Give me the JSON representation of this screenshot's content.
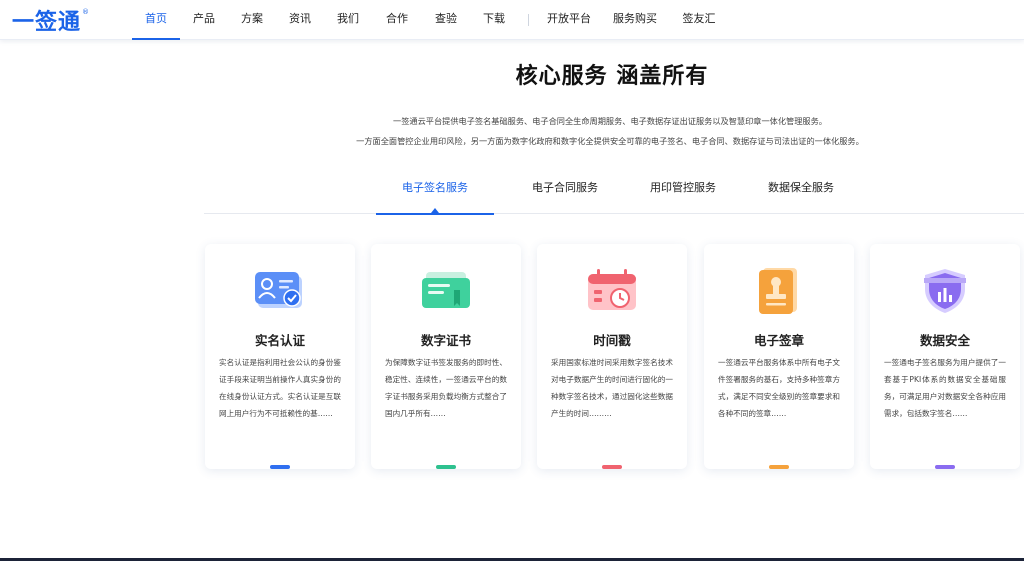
{
  "logo": {
    "text": "一签通",
    "mark": "®"
  },
  "nav": [
    {
      "label": "首页",
      "active": true
    },
    {
      "label": "产品"
    },
    {
      "label": "方案"
    },
    {
      "label": "资讯"
    },
    {
      "label": "我们"
    },
    {
      "label": "合作"
    },
    {
      "label": "查验"
    },
    {
      "label": "下载"
    },
    {
      "label": "开放平台"
    },
    {
      "label": "服务购买"
    },
    {
      "label": "签友汇"
    }
  ],
  "hero": {
    "headline": "核心服务 涵盖所有",
    "desc1": "一签通云平台提供电子签名基础服务、电子合同全生命周期服务、电子数据存证出证服务以及智慧印章一体化管理服务。",
    "desc2": "一方面全面管控企业用印风险，另一方面为数字化政府和数字化全提供安全可靠的电子签名、电子合同、数据存证与司法出证的一体化服务。"
  },
  "tabs": [
    {
      "label": "电子签名服务",
      "active": true
    },
    {
      "label": "电子合同服务"
    },
    {
      "label": "用印管控服务"
    },
    {
      "label": "数据保全服务"
    }
  ],
  "cards": [
    {
      "title": "实名认证",
      "icon": "id-card-icon",
      "color": "#2f6ff0",
      "text": "实名认证是指利用社会公认的身份鉴证手段来证明当前操作人真实身份的在线身份认证方式。实名认证是互联网上用户行为不可抵赖性的基……"
    },
    {
      "title": "数字证书",
      "icon": "certificate-icon",
      "color": "#2ec18f",
      "text": "为保障数字证书签发服务的即时性、稳定性、连续性，一签通云平台的数字证书服务采用负载均衡方式整合了国内几乎所有……"
    },
    {
      "title": "时间戳",
      "icon": "calendar-clock-icon",
      "color": "#f0636f",
      "text": "采用国家标准时间采用数字签名技术对电子数据产生的时间进行固化的一种数字签名技术，通过固化这些数据产生的时间………"
    },
    {
      "title": "电子签章",
      "icon": "seal-stamp-icon",
      "color": "#f5a23c",
      "text": "一签通云平台服务体系中所有电子文件签署服务的基石，支持多种签章方式，满足不同安全级别的签章要求和各种不同的签章……"
    },
    {
      "title": "数据安全",
      "icon": "shield-chart-icon",
      "color": "#8a6cf0",
      "text": "一签通电子签名服务为用户提供了一套基于PKI体系的数据安全基础服务，可满足用户对数据安全各种应用需求，包括数字签名……"
    }
  ]
}
